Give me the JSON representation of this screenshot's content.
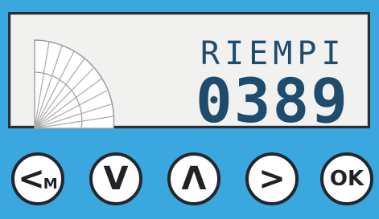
{
  "display": {
    "mode_label": "RIEMPI",
    "counter": "0389",
    "counter_color": "#1f4b6c",
    "panel_background": "#f1f2f0"
  },
  "buttons": [
    {
      "name": "menu-back-button",
      "glyph": "<",
      "sub": "M"
    },
    {
      "name": "down-button",
      "glyph": "V",
      "sub": ""
    },
    {
      "name": "up-button",
      "glyph": "Λ",
      "sub": ""
    },
    {
      "name": "forward-button",
      "glyph": ">",
      "sub": ""
    },
    {
      "name": "ok-button",
      "glyph": "OK",
      "sub": ""
    }
  ],
  "colors": {
    "background": "#3aa7df",
    "button_fill": "#ffffff",
    "button_border": "#23262a"
  }
}
